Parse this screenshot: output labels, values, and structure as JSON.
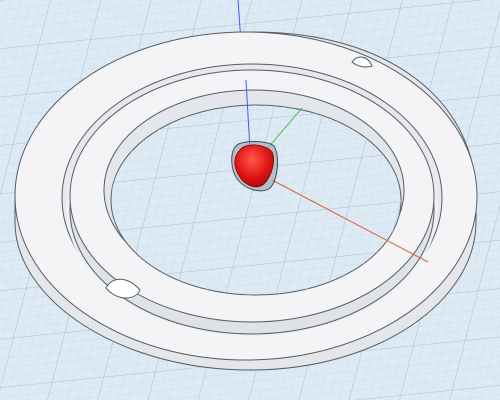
{
  "workplane": {
    "background": "#dde9f3",
    "grid_minor": "#c4d9ea",
    "grid_major": "#9dbcd6"
  },
  "axes": {
    "x_color": "#e0603a",
    "y_color": "#4fc14f",
    "z_color": "#3b5ff0"
  },
  "objects": [
    {
      "name": "outer-ring",
      "color": "#f2f2f4"
    },
    {
      "name": "inner-ring",
      "color": "#f2f2f4"
    },
    {
      "name": "selected-shape",
      "color": "#e01414"
    }
  ],
  "icons": {
    "selected_shape": "red-rounded-cone"
  }
}
